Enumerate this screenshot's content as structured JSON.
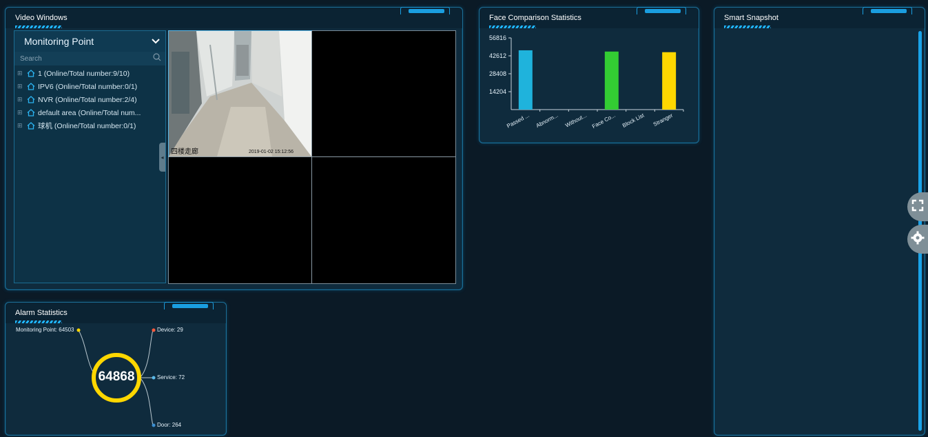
{
  "video_windows": {
    "title": "Video Windows",
    "tree": {
      "header": "Monitoring Point",
      "search_placeholder": "Search",
      "items": [
        {
          "label": "1 (Online/Total number:9/10)"
        },
        {
          "label": "IPV6 (Online/Total number:0/1)"
        },
        {
          "label": "NVR (Online/Total number:2/4)"
        },
        {
          "label": "default area (Online/Total num..."
        },
        {
          "label": "球机 (Online/Total number:0/1)"
        }
      ]
    },
    "camera": {
      "name": "四楼走廊",
      "timestamp": "2019-01-02 15:12:56"
    }
  },
  "face_stats": {
    "title": "Face Comparison Statistics",
    "chart_data": {
      "type": "bar",
      "categories": [
        "Passed ...",
        "Abnorm...",
        "Without...",
        "Face Co...",
        "Block List",
        "Stranger"
      ],
      "values": [
        47000,
        0,
        0,
        46000,
        0,
        45500
      ],
      "yticks": [
        56816,
        42612,
        28408,
        14204
      ],
      "ylim": [
        0,
        56816
      ],
      "colors": [
        "#1fb3dc",
        "#1fb3dc",
        "#1fb3dc",
        "#33cc33",
        "#ff3333",
        "#ffd700"
      ],
      "xlabel": "",
      "ylabel": "",
      "title": ""
    }
  },
  "smart_snapshot": {
    "title": "Smart Snapshot"
  },
  "alarm_stats": {
    "title": "Alarm Statistics",
    "total": "64868",
    "monitoring_point": "Monitoring Point: 64503",
    "device": "Device: 29",
    "service": "Service: 72",
    "door": "Door: 264"
  },
  "colors": {
    "accent": "#1a9ee0",
    "panel_bg": "#0f2b3d",
    "ring": "#ffd700"
  }
}
